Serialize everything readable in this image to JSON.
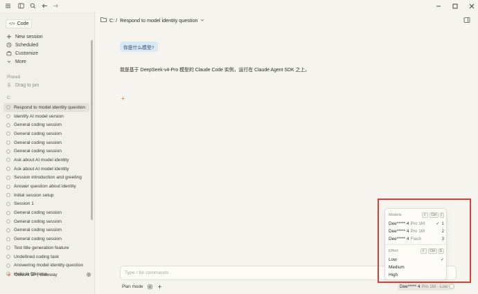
{
  "sidebar": {
    "mode_label": "Code",
    "nav": [
      "New session",
      "Scheduled",
      "Customize",
      "More"
    ],
    "pinned_label": "Pinned",
    "drag_to_pin": "Drag to pin",
    "drive_label": "C:",
    "sessions": [
      "Respond to model identity question",
      "Identify AI model version",
      "General coding session",
      "General coding session",
      "General coding session",
      "General coding session",
      "Ask about AI model identity",
      "Ask about AI model identity",
      "Session introduction and greeting",
      "Answer question about identity",
      "Initial session setup",
      "Session 1",
      "General coding session",
      "General coding session",
      "General coding session",
      "General coding session",
      "Test title generation feature",
      "Undefined coding task",
      "Answering model identity question",
      "Hello in Chinese"
    ],
    "footer": "Cowork 3P | Gateway"
  },
  "header": {
    "path_prefix": "C: /",
    "title": "Respond to model identity question"
  },
  "conversation": {
    "user_message": "你是什么模型?",
    "assistant_message": "我是基于 DeepSeek-v4-Pro 模型的 Claude Code 实例，运行在 Claude Agent SDK 之上。"
  },
  "composer": {
    "placeholder": "Type / for commands",
    "plan_mode": "Plan mode",
    "model_pill_name": "Dee***** 4",
    "model_pill_detail": "Pro 1M · Low"
  },
  "model_menu": {
    "models_label": "Models",
    "models_keys": [
      "⇧",
      "Ctrl",
      "I"
    ],
    "models": [
      {
        "name": "Dee***** 4",
        "detail": "Pro 1M",
        "checked": true,
        "shortcut": "1"
      },
      {
        "name": "Dee***** 4",
        "detail": "Pro 1M",
        "checked": false,
        "shortcut": "2"
      },
      {
        "name": "Dee***** 4",
        "detail": "Flash",
        "checked": false,
        "shortcut": "3"
      }
    ],
    "effort_label": "Effort",
    "effort_keys": [
      "⇧",
      "Ctrl",
      "E"
    ],
    "effort": [
      {
        "label": "Low",
        "checked": true
      },
      {
        "label": "Medium",
        "checked": false
      },
      {
        "label": "High",
        "checked": false
      }
    ],
    "check_glyph": "✓"
  },
  "colors": {
    "accent": "#d97757",
    "highlight": "#e03a32",
    "user_bubble": "#dbe8f6"
  }
}
